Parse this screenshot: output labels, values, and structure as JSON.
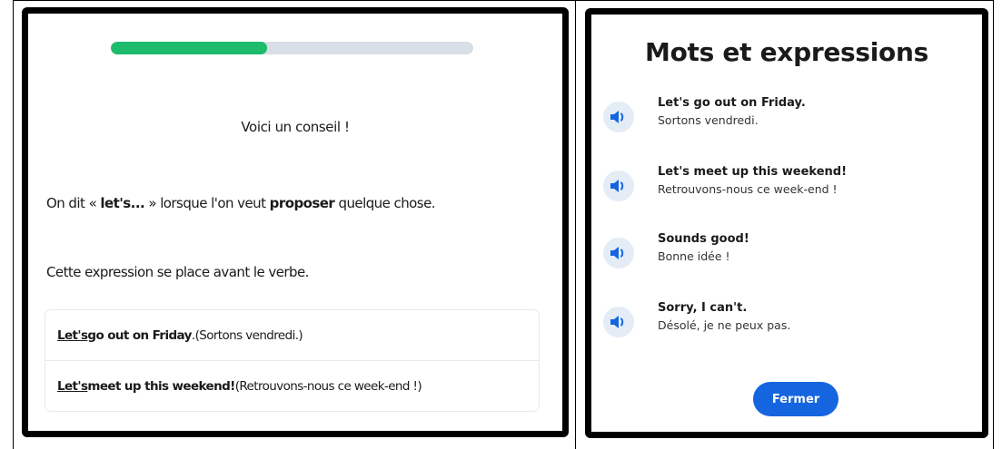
{
  "tip_screen": {
    "progress": 0.43,
    "progress_color": "#1dbb6b",
    "track_color": "#d8dfe6",
    "title": "Voici un conseil !",
    "line1": {
      "a": "On dit « ",
      "b": "let's...",
      "c": " » lorsque l'on veut ",
      "d": "proposer",
      "e": " quelque chose."
    },
    "line2": "Cette expression se place avant le verbe.",
    "examples": [
      {
        "key": "Let's",
        "rest": " go out on Friday",
        "punct": ".",
        "translation": " (Sortons vendredi.)"
      },
      {
        "key": "Let's",
        "rest": " meet up this weekend!",
        "punct": "",
        "translation": " (Retrouvons-nous ce week-end !)"
      }
    ]
  },
  "vocab_screen": {
    "title": "Mots et expressions",
    "speaker_icon": "speaker-icon",
    "accent_color": "#1565e0",
    "phrases": [
      {
        "en": "Let's go out on Friday.",
        "fr": "Sortons vendredi."
      },
      {
        "en": "Let's meet up this weekend!",
        "fr": "Retrouvons-nous ce week-end !"
      },
      {
        "en": "Sounds good!",
        "fr": "Bonne idée !"
      },
      {
        "en": "Sorry, I can't.",
        "fr": "Désolé, je ne peux pas."
      }
    ],
    "close_label": "Fermer"
  }
}
